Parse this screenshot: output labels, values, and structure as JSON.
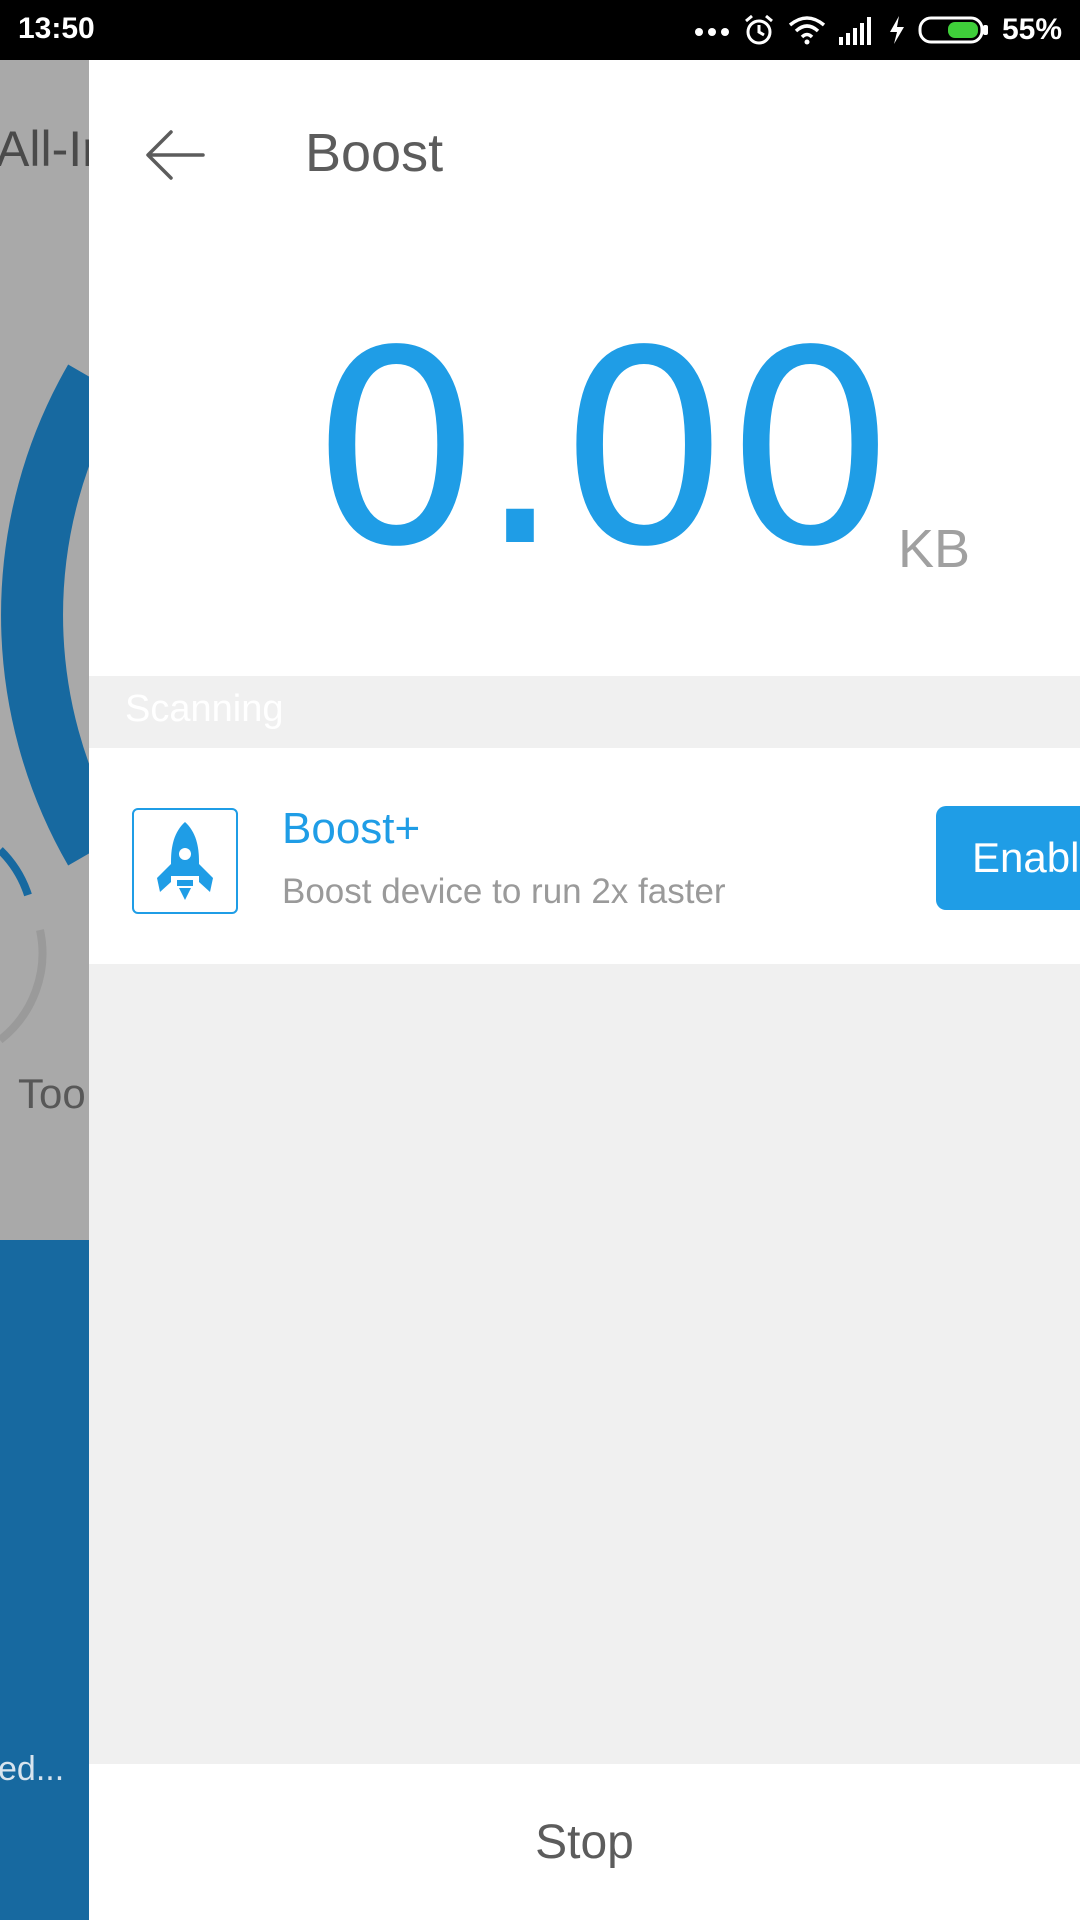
{
  "status_bar": {
    "time": "13:50",
    "battery_percent": "55%",
    "icons": [
      "more-dots-icon",
      "alarm-icon",
      "wifi-icon",
      "signal-icon",
      "charging-icon",
      "battery-icon"
    ]
  },
  "background_app": {
    "title_fragment": "All-Ir",
    "tool_fragment": "Too",
    "status_fragment": "ed..."
  },
  "header": {
    "title": "Boost",
    "back_icon": "arrow-left-icon"
  },
  "memory": {
    "value": "0.00",
    "unit": "KB"
  },
  "section": {
    "label": "Scanning"
  },
  "feature": {
    "icon": "rocket-icon",
    "title": "Boost+",
    "description": "Boost device to run 2x faster",
    "button_label": "Enable"
  },
  "footer": {
    "stop_label": "Stop"
  },
  "colors": {
    "accent": "#1f9de6",
    "panel_bg": "#f0f0f0",
    "background_overlay": "#a9a9a9",
    "background_blue": "#1769a0"
  }
}
